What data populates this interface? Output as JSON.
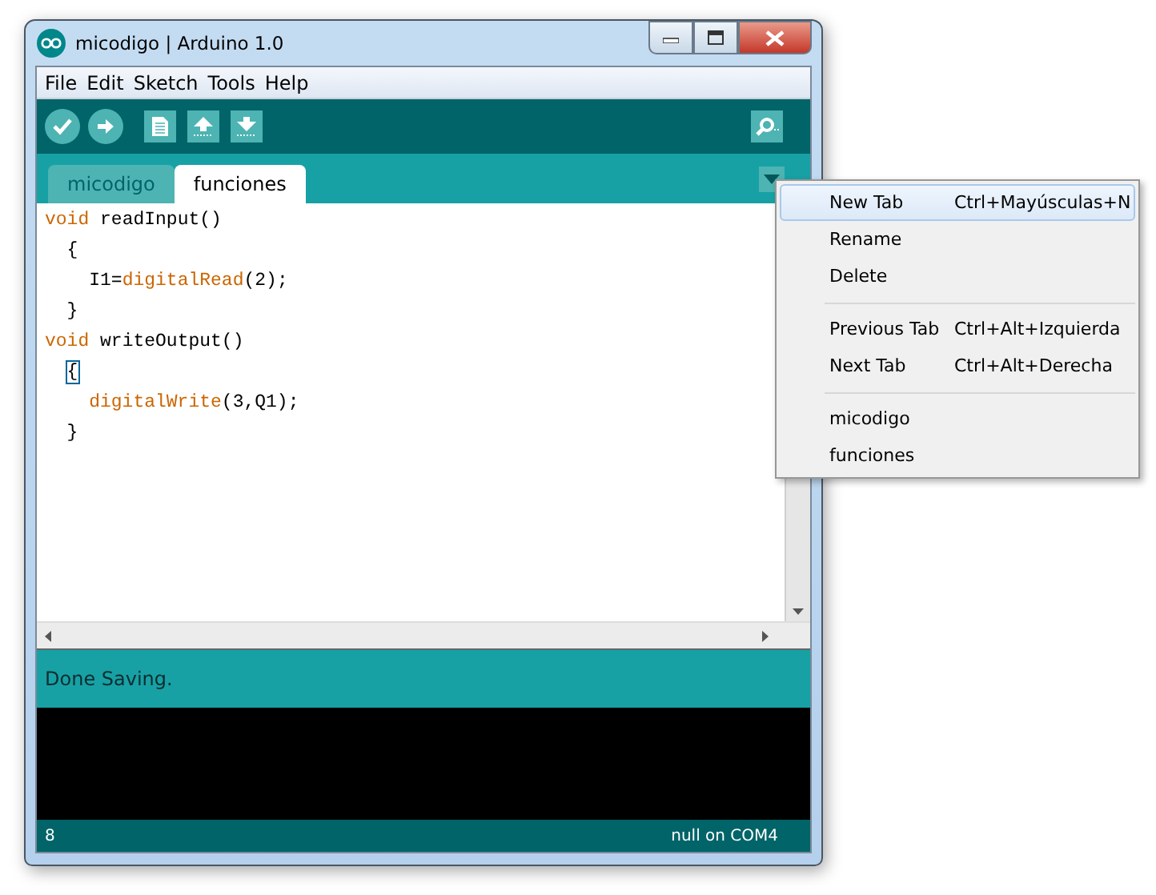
{
  "window": {
    "title": "micodigo | Arduino 1.0"
  },
  "menubar": [
    "File",
    "Edit",
    "Sketch",
    "Tools",
    "Help"
  ],
  "tabs": [
    {
      "label": "micodigo",
      "selected": false
    },
    {
      "label": "funciones",
      "selected": true
    }
  ],
  "editor": {
    "lines": [
      {
        "kind": "declaration",
        "segments": [
          {
            "text": "void",
            "kind": "keyword"
          },
          {
            "text": " readInput()",
            "kind": "plain"
          }
        ]
      },
      {
        "kind": "brace",
        "segments": [
          {
            "text": "{",
            "kind": "plain"
          }
        ]
      },
      {
        "kind": "statement",
        "segments": [
          {
            "text": "I1=",
            "kind": "plain"
          },
          {
            "text": "digitalRead",
            "kind": "function"
          },
          {
            "text": "(2);",
            "kind": "plain"
          }
        ]
      },
      {
        "kind": "brace",
        "segments": [
          {
            "text": "}",
            "kind": "plain"
          }
        ]
      },
      {
        "kind": "declaration",
        "segments": [
          {
            "text": "void",
            "kind": "keyword"
          },
          {
            "text": " writeOutput()",
            "kind": "plain"
          }
        ]
      },
      {
        "kind": "brace",
        "segments": [
          {
            "text": "{",
            "kind": "caret"
          }
        ]
      },
      {
        "kind": "statement",
        "segments": [
          {
            "text": "digitalWrite",
            "kind": "function"
          },
          {
            "text": "(3,Q1);",
            "kind": "plain"
          }
        ]
      },
      {
        "kind": "brace",
        "segments": [
          {
            "text": "}",
            "kind": "plain"
          }
        ]
      }
    ]
  },
  "status": {
    "message": "Done Saving."
  },
  "footer": {
    "line": "8",
    "port": "null on COM4"
  },
  "tab_menu": {
    "sections": [
      [
        {
          "label": "New Tab",
          "shortcut": "Ctrl+Mayúsculas+N",
          "selected": true
        },
        {
          "label": "Rename",
          "selected": false
        },
        {
          "label": "Delete",
          "selected": false
        }
      ],
      [
        {
          "label": "Previous Tab",
          "shortcut": "Ctrl+Alt+Izquierda",
          "selected": false
        },
        {
          "label": "Next Tab",
          "shortcut": "Ctrl+Alt+Derecha",
          "selected": false
        }
      ],
      [
        {
          "label": "micodigo",
          "selected": false
        },
        {
          "label": "funciones",
          "selected": false
        }
      ]
    ]
  }
}
